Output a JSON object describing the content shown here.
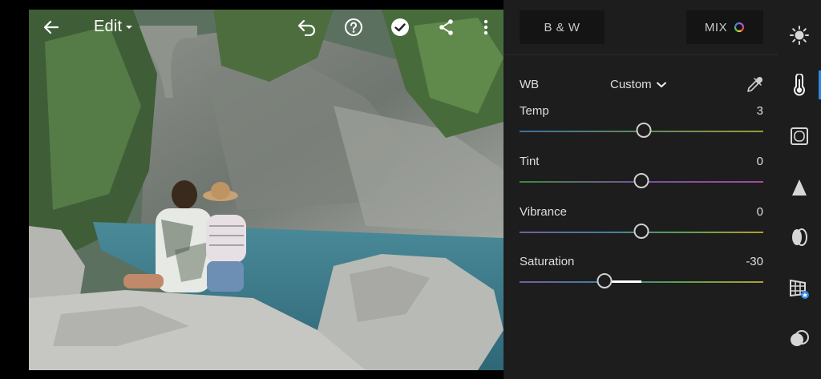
{
  "toolbar": {
    "title": "Edit",
    "icons": [
      "back-arrow-icon",
      "undo-icon",
      "help-icon",
      "checkmark-icon",
      "share-icon",
      "more-vert-icon"
    ]
  },
  "panel": {
    "bw_label": "B & W",
    "mix_label": "MIX",
    "wb": {
      "label": "WB",
      "value": "Custom"
    },
    "sliders": [
      {
        "label": "Temp",
        "value": "3",
        "position": 0.51,
        "gradient": [
          "#3b6fa0",
          "#5c8a5c",
          "#9a9a3a"
        ]
      },
      {
        "label": "Tint",
        "value": "0",
        "position": 0.5,
        "gradient": [
          "#3c8a3c",
          "#7a4fa0",
          "#a04aa0"
        ]
      },
      {
        "label": "Vibrance",
        "value": "0",
        "position": 0.5,
        "gradient": [
          "#7a5aa0",
          "#3e7fa0",
          "#5aa050",
          "#b0a030"
        ]
      },
      {
        "label": "Saturation",
        "value": "-30",
        "position": 0.35,
        "gradient": [
          "#7a5aa0",
          "#3e7fa0",
          "#5aa050",
          "#b0a030"
        ]
      }
    ]
  },
  "sidebar": {
    "icons": [
      "light-icon",
      "color-icon",
      "effects-icon",
      "detail-icon",
      "optics-icon",
      "geometry-icon",
      "presets-icon"
    ],
    "active_color": "#2f88e6"
  }
}
